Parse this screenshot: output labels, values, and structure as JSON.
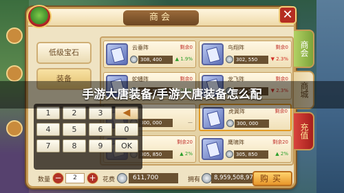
{
  "panel": {
    "title": "商会",
    "close_symbol": "✕"
  },
  "side_tabs": [
    {
      "label": "商会"
    },
    {
      "label": "商城"
    },
    {
      "label": "充值"
    }
  ],
  "categories": [
    {
      "label": "低级宝石"
    },
    {
      "label": "装备"
    }
  ],
  "items": [
    {
      "name": "云垂阵",
      "stock": "剩余0",
      "price": "308, 400",
      "trend": "1.9%",
      "trend_dir": "up"
    },
    {
      "name": "鸟翔阵",
      "stock": "剩余0",
      "price": "302, 550",
      "trend": "2.3%",
      "trend_dir": "down"
    },
    {
      "name": "蛇蟠阵",
      "stock": "剩余0",
      "price": "302, 550",
      "trend": "2.3%",
      "trend_dir": "up"
    },
    {
      "name": "龙飞阵",
      "stock": "剩余0",
      "price": "302, 550",
      "trend": "2.3%",
      "trend_dir": "down"
    },
    {
      "name": "",
      "stock": "",
      "price": "300, 000",
      "trend": "—",
      "trend_dir": "flat"
    },
    {
      "name": "虎翼阵",
      "stock": "剩余0",
      "price": "300, 000",
      "trend": "",
      "trend_dir": "flat"
    },
    {
      "name": "",
      "stock": "剩余20",
      "price": "305, 850",
      "trend": "2%",
      "trend_dir": "up"
    },
    {
      "name": "鹰啸阵",
      "stock": "剩余20",
      "price": "305, 850",
      "trend": "2%",
      "trend_dir": "up"
    }
  ],
  "numpad": {
    "keys": [
      "1",
      "2",
      "3",
      "4",
      "5",
      "6",
      "0",
      "7",
      "8",
      "9",
      "OK"
    ],
    "backspace": "◀"
  },
  "bottom": {
    "quantity_label": "数量",
    "minus": "−",
    "quantity": "2",
    "plus": "+",
    "cost_label": "花费",
    "cost_value": "611,700",
    "own_label": "拥有",
    "own_value": "8,959,508,977",
    "buy_label": "购买"
  },
  "overlay_caption": "手游大唐装备/手游大唐装备怎么配"
}
